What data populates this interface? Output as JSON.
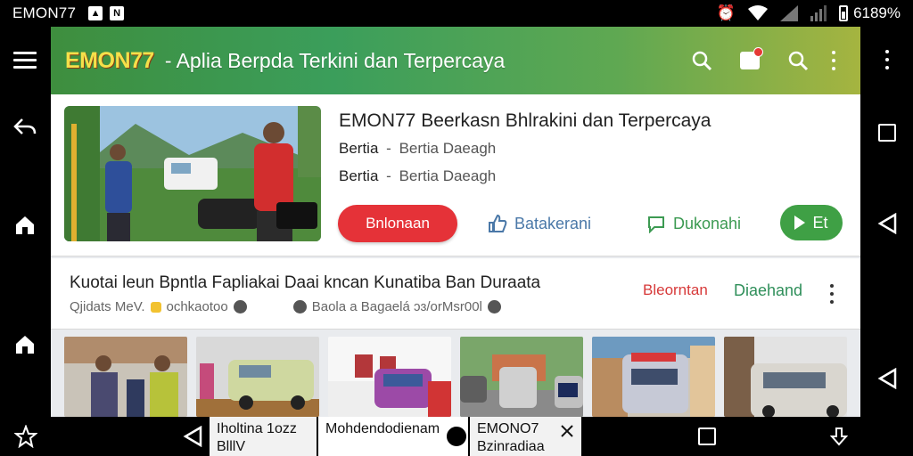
{
  "status_bar": {
    "app_label": "EMON77",
    "battery_text": "6189%"
  },
  "app_bar": {
    "logo": "EMON77",
    "title": "- Aplia Berpda Terkini dan Terpercaya"
  },
  "featured": {
    "title": "EMON77 Beerkasn Bhlrakini dan Terpercaya",
    "line1_a": "Bertia",
    "line1_sep": "-",
    "line1_b": "Bertia Daeagh",
    "line2_a": "Bertia",
    "line2_sep": "-",
    "line2_b": "Bertia Daeagh",
    "btn_primary": "Bnlonaan",
    "btn_blue": "Batakerani",
    "btn_green_link": "Dukonahi",
    "btn_play": "Et"
  },
  "article": {
    "title": "Kuotai leun Bpntla Fapliakai Daai kncan Kunatiba Ban Duraata",
    "meta_left": "Qjidats MeV.",
    "meta_mid": "ochkaotoo",
    "meta_right": "Baola a Bagaelá ɔɜ/orMsr00l",
    "red_link": "Bleorntan",
    "green_link": "Diaehand"
  },
  "tray": {
    "item1_line1": "Iholtina 1ozz",
    "item1_line2": "BlllV",
    "item2_line1": "Mohdendodienam",
    "item3_line1": "EMONO7",
    "item3_line2": "Bzinradiaa"
  },
  "colors": {
    "appbar_start": "#3e8e3e",
    "appbar_end": "#a5b440",
    "primary_red": "#e53238",
    "accent_green": "#3fa045",
    "link_blue": "#4a78a8"
  }
}
